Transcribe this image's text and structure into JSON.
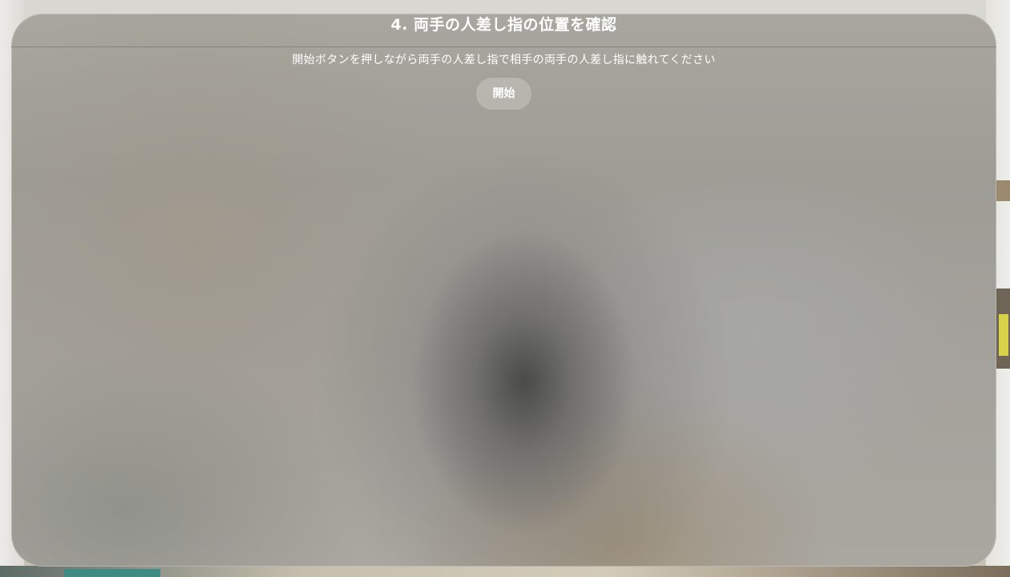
{
  "window": {
    "title": "4. 両手の人差し指の位置を確認",
    "instruction": "開始ボタンを押しながら両手の人差し指で相手の両手の人差し指に触れてください",
    "start_button_label": "開始"
  },
  "colors": {
    "text": "#ffffff",
    "glass": "#a3a19b",
    "button": "#c8c6c0"
  }
}
